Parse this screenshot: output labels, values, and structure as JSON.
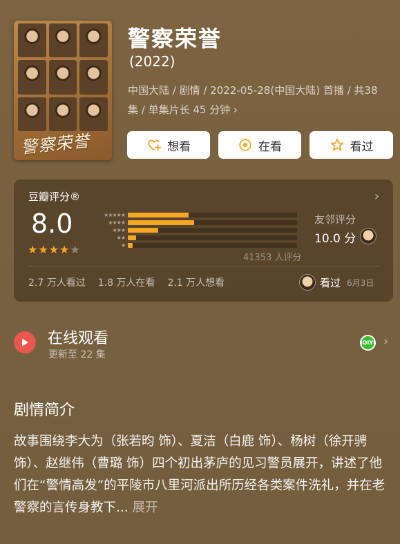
{
  "movie": {
    "title": "警察荣誉",
    "year": "(2022)",
    "poster_logo": "警察荣誉",
    "meta_line1": "中国大陆 / 剧情 / 2022-05-28(中国大陆) 首播 / 共38",
    "meta_line2": "集 / 单集片长 45 分钟 ›"
  },
  "actions": {
    "want_label": "想看",
    "watching_label": "在看",
    "watched_label": "看过"
  },
  "rating": {
    "title": "豆瓣评分®",
    "score": "8.0",
    "stars": 4,
    "distribution": [
      {
        "stars": "★★★★★",
        "fraction": 0.36
      },
      {
        "stars": "★★★★",
        "fraction": 0.39
      },
      {
        "stars": "★★★",
        "fraction": 0.18
      },
      {
        "stars": "★★",
        "fraction": 0.05
      },
      {
        "stars": "★",
        "fraction": 0.03
      }
    ],
    "count": "41353 人评分",
    "friend_label": "友邻评分",
    "friend_score": "10.0 分",
    "watched_count": "2.7 万人看过",
    "watching_count": "1.8 万人在看",
    "want_count": "2.1 万人想看",
    "seen_label": "看过",
    "seen_date": "6月3日"
  },
  "online": {
    "title": "在线观看",
    "subtitle": "更新至 22 集",
    "provider_text": "iQIYI"
  },
  "synopsis": {
    "title": "剧情简介",
    "text": "故事围绕李大为（张若昀 饰）、夏洁（白鹿 饰）、杨树（徐开骋 饰）、赵继伟（曹璐 饰）四个初出茅庐的见习警员展开，讲述了他们在“警情高发”的平陵市八里河派出所历经各类案件洗礼，并在老警察的言传身教下...",
    "more": "展开"
  },
  "colors": {
    "background": "#7a6140",
    "star": "#f5a623",
    "play": "#e8584f",
    "iqiyi": "#3bbd35"
  }
}
